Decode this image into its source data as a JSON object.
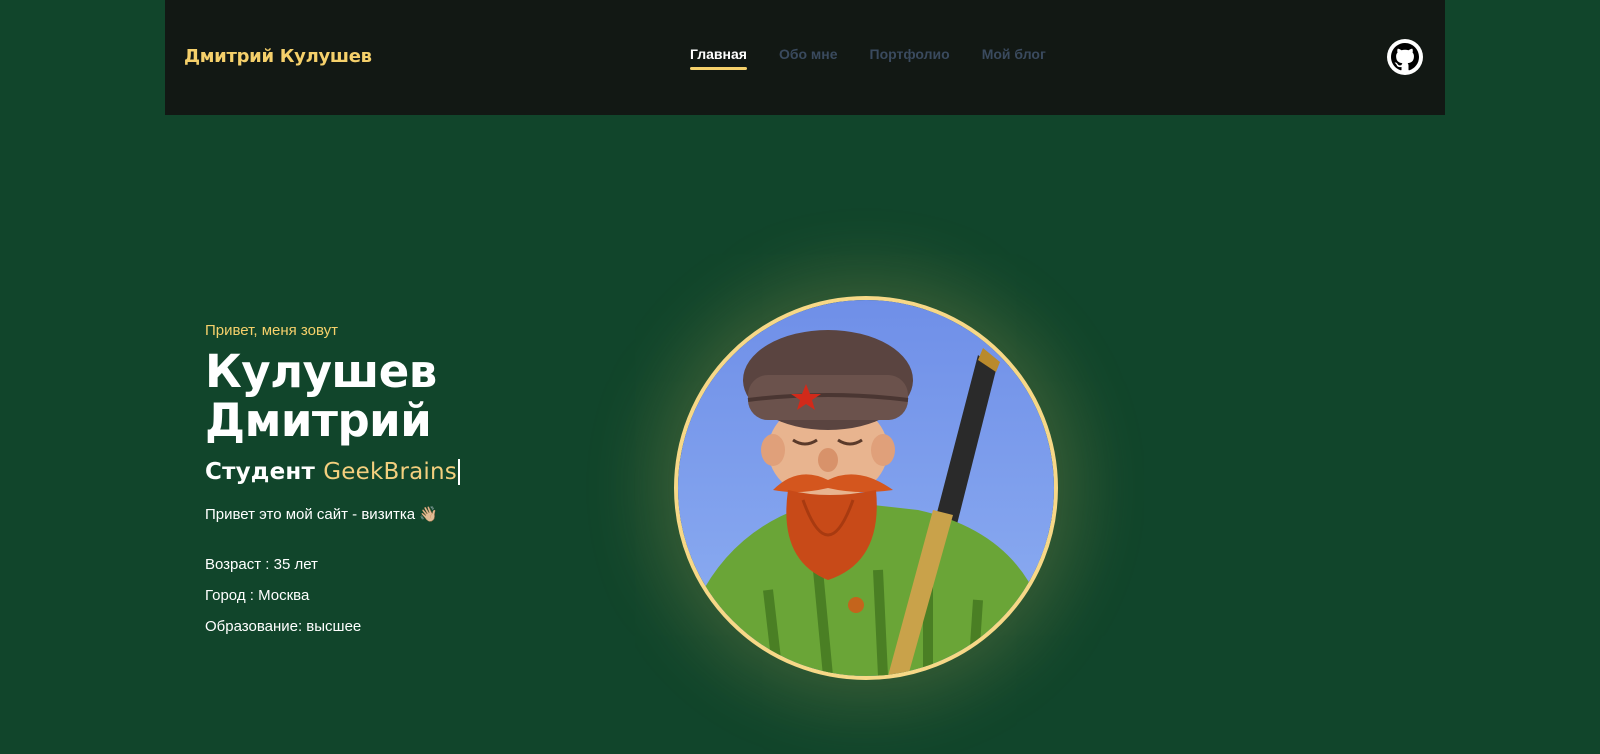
{
  "header": {
    "brand": "Дмитрий Кулушев",
    "nav": [
      {
        "label": "Главная",
        "active": true
      },
      {
        "label": "Обо мне",
        "active": false
      },
      {
        "label": "Портфолио",
        "active": false
      },
      {
        "label": "Мой блог",
        "active": false
      }
    ],
    "github_icon": "github-icon"
  },
  "hero": {
    "greeting": "Привет, меня зовут",
    "name_line1": "Кулушев",
    "name_line2": "Дмитрий",
    "role_prefix": "Студент",
    "role_accent": "GeekBrains",
    "intro": "Привет это мой сайт - визитка",
    "intro_emoji": "👋🏼",
    "facts": [
      "Возраст : 35 лет",
      "Город : Москва",
      "Образование: высшее"
    ]
  },
  "colors": {
    "background": "#11452b",
    "header_bg": "#121814",
    "accent": "#f5d06b",
    "nav_inactive": "#3a4a5e"
  }
}
